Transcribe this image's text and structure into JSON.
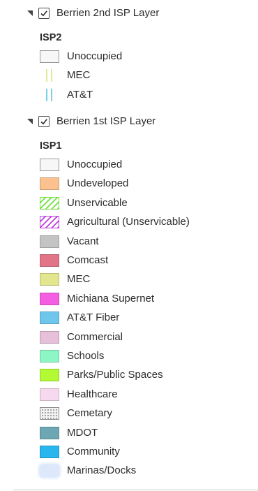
{
  "layers": [
    {
      "name": "Berrien 2nd ISP Layer",
      "checked": true,
      "group": "ISP2",
      "items": [
        {
          "label": "Unoccupied",
          "swatch": "outline",
          "color": "#f7f7f7"
        },
        {
          "label": "MEC",
          "swatch": "double-line",
          "color": "#e4e89a"
        },
        {
          "label": "AT&T",
          "swatch": "double-line",
          "color": "#7ccfe8"
        }
      ]
    },
    {
      "name": "Berrien 1st ISP Layer",
      "checked": true,
      "group": "ISP1",
      "items": [
        {
          "label": "Unoccupied",
          "swatch": "outline",
          "color": "#f7f7f7"
        },
        {
          "label": "Undeveloped",
          "swatch": "solid",
          "color": "#fbc28f"
        },
        {
          "label": "Unservicable",
          "swatch": "hatch",
          "color": "#70e03a"
        },
        {
          "label": "Agricultural (Unservicable)",
          "swatch": "hatch",
          "color": "#c13ee0"
        },
        {
          "label": "Vacant",
          "swatch": "solid",
          "color": "#c4c4c4"
        },
        {
          "label": "Comcast",
          "swatch": "solid",
          "color": "#e17587"
        },
        {
          "label": "MEC",
          "swatch": "solid",
          "color": "#e2e68e"
        },
        {
          "label": "Michiana Supernet",
          "swatch": "solid",
          "color": "#f45ee0"
        },
        {
          "label": "AT&T Fiber",
          "swatch": "solid",
          "color": "#6fc6ec"
        },
        {
          "label": "Commercial",
          "swatch": "solid",
          "color": "#e5c0d8"
        },
        {
          "label": "Schools",
          "swatch": "solid",
          "color": "#8ef5c5"
        },
        {
          "label": "Parks/Public Spaces",
          "swatch": "solid",
          "color": "#b3fa35"
        },
        {
          "label": "Healthcare",
          "swatch": "solid",
          "color": "#f6d9ee"
        },
        {
          "label": "Cemetary",
          "swatch": "dotted",
          "color": "#f2f2f2"
        },
        {
          "label": "MDOT",
          "swatch": "solid",
          "color": "#6ea7b4"
        },
        {
          "label": "Community",
          "swatch": "solid",
          "color": "#29b6ef"
        },
        {
          "label": "Marinas/Docks",
          "swatch": "soft",
          "color": "#dde9fb"
        }
      ]
    }
  ]
}
